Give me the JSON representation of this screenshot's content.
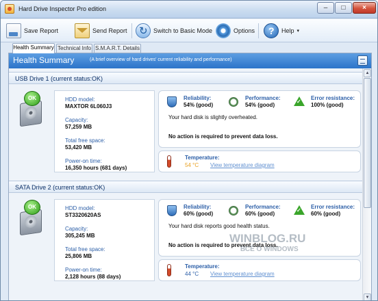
{
  "window": {
    "title": "Hard Drive Inspector Pro edition",
    "minimize": "–",
    "maximize": "□",
    "close": "×"
  },
  "toolbar": {
    "save_report": "Save Report",
    "send_report": "Send Report",
    "switch_mode": "Switch to Basic Mode",
    "options": "Options",
    "help": "Help",
    "help_arrow": "▾"
  },
  "tabs": [
    "Health Summary",
    "Technical Info",
    "S.M.A.R.T. Details"
  ],
  "health_header": {
    "title": "Health Summary",
    "description": "(A brief overview of hard drives' current reliability and performance)"
  },
  "scrollbar": {
    "up": "▲",
    "down": "▼"
  },
  "drives": [
    {
      "title": "USB Drive 1 (current status:OK)",
      "badge": "OK",
      "model_label": "HDD model:",
      "model": "MAXTOR 6L060J3",
      "capacity_label": "Capacity:",
      "capacity": "57,259 MB",
      "free_label": "Total free space:",
      "free": "53,420 MB",
      "power_label": "Power-on time:",
      "power": "16,350 hours (681 days)",
      "reliability_label": "Reliability:",
      "reliability": "54% (good)",
      "performance_label": "Performance:",
      "performance": "54% (good)",
      "error_label": "Error resistance:",
      "error": "100% (good)",
      "message": "Your hard disk is slightly overheated.",
      "action": "No action is required to prevent data loss.",
      "temp_label": "Temperature:",
      "temp": "54 °C",
      "temp_link": "View temperature diagram"
    },
    {
      "title": "SATA Drive 2 (current status:OK)",
      "badge": "OK",
      "model_label": "HDD model:",
      "model": "ST3320620AS",
      "capacity_label": "Capacity:",
      "capacity": "305,245 MB",
      "free_label": "Total free space:",
      "free": "25,806 MB",
      "power_label": "Power-on time:",
      "power": "2,128 hours (88 days)",
      "reliability_label": "Reliability:",
      "reliability": "60% (good)",
      "performance_label": "Performance:",
      "performance": "60% (good)",
      "error_label": "Error resistance:",
      "error": "60% (good)",
      "message": "Your hard disk reports good health status.",
      "action": "No action is required to prevent data loss.",
      "temp_label": "Temperature:",
      "temp": "44 °C",
      "temp_link": "View temperature diagram"
    }
  ],
  "watermark": {
    "main": "WINBLOG.RU",
    "sub": "ВСЁ О WINDOWS"
  },
  "colors": {
    "accent": "#2c74c9",
    "ok": "#2a9a14",
    "temp_warn": "#e8a020"
  }
}
